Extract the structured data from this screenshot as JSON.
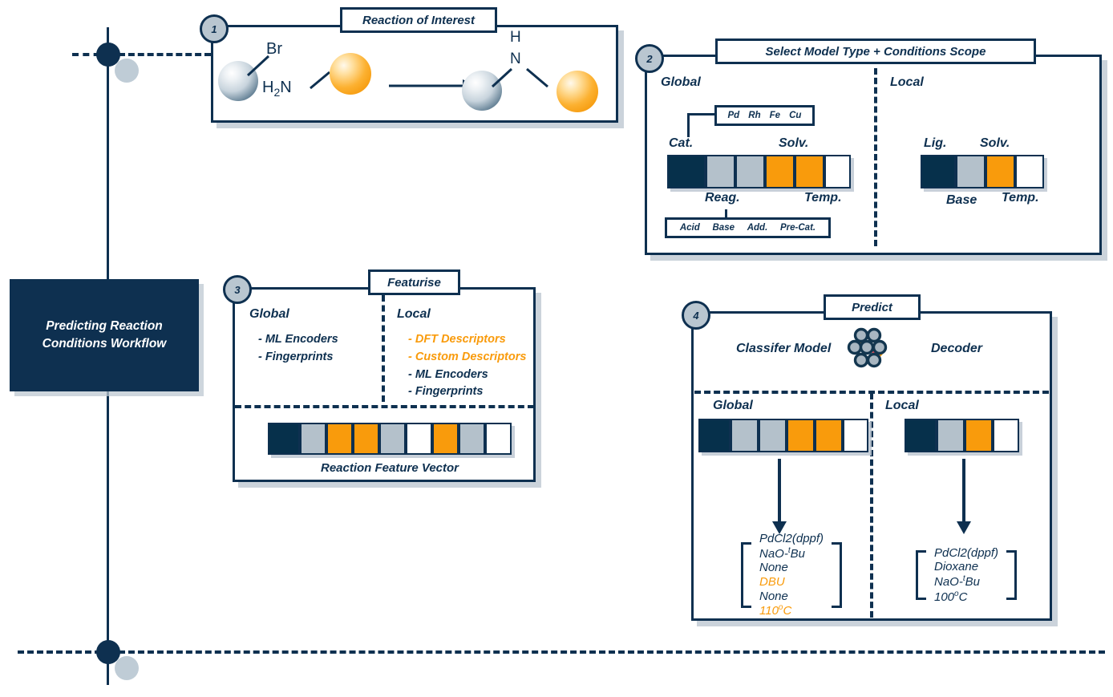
{
  "workflow": {
    "title": "Predicting Reaction\nConditions Workflow"
  },
  "colors": {
    "navy": "#0e3050",
    "cell_navy": "#06304b",
    "gray": "#b4c1cb",
    "orange": "#f99b0c",
    "white": "#ffffff",
    "badge_gray": "#b9c6d0",
    "shadow": "#bec8d2"
  },
  "steps": [
    {
      "number": "1",
      "title": "Reaction of Interest"
    },
    {
      "number": "2",
      "title": "Select Model Type + Conditions Scope"
    },
    {
      "number": "3",
      "title": "Featurise"
    },
    {
      "number": "4",
      "title": "Predict"
    }
  ],
  "step1": {
    "reactant1": {
      "label": "Br",
      "sphere": "gray-sphere"
    },
    "reactant2": {
      "label": "H2N",
      "label_main": "H",
      "label_sub": "2",
      "label_tail": "N",
      "sphere": "orange-sphere"
    },
    "arrow": "reaction-arrow",
    "product": {
      "n_label": "N",
      "h_label": "H",
      "sphere_left": "gray-sphere",
      "sphere_right": "orange-sphere"
    }
  },
  "step2": {
    "global_label": "Global",
    "local_label": "Local",
    "catalyst_options": [
      "Pd",
      "Rh",
      "Fe",
      "Cu"
    ],
    "reagent_options": [
      "Acid",
      "Base",
      "Add.",
      "Pre-Cat."
    ],
    "global_top_labels": {
      "cat": "Cat.",
      "solv": "Solv."
    },
    "global_bottom_labels": {
      "reag": "Reag.",
      "temp": "Temp."
    },
    "local_top_labels": {
      "lig": "Lig.",
      "solv": "Solv."
    },
    "local_bottom_labels": {
      "base": "Base",
      "temp": "Temp."
    },
    "global_bar": [
      "navy",
      "gray",
      "gray",
      "orange",
      "orange",
      "white"
    ],
    "local_bar": [
      "navy",
      "gray",
      "orange",
      "white"
    ]
  },
  "step3": {
    "global_label": "Global",
    "local_label": "Local",
    "global_items": [
      {
        "text": "- ML Encoders",
        "highlight": false
      },
      {
        "text": "- Fingerprints",
        "highlight": false
      }
    ],
    "local_items": [
      {
        "text": "- DFT Descriptors",
        "highlight": true
      },
      {
        "text": "- Custom Descriptors",
        "highlight": true
      },
      {
        "text": "- ML Encoders",
        "highlight": false
      },
      {
        "text": "- Fingerprints",
        "highlight": false
      }
    ],
    "vector_caption": "Reaction Feature Vector",
    "vector_bar": [
      "navy",
      "gray",
      "orange",
      "orange",
      "gray",
      "white",
      "orange",
      "gray",
      "white"
    ]
  },
  "step4": {
    "classifier_label": "Classifer Model",
    "decoder_label": "Decoder",
    "network_icon": "neural-network-icon",
    "global_label": "Global",
    "local_label": "Local",
    "global_bar": [
      "navy",
      "gray",
      "gray",
      "orange",
      "orange",
      "white"
    ],
    "local_bar": [
      "navy",
      "gray",
      "orange",
      "white"
    ],
    "global_prediction": [
      {
        "text": "PdCl2(dppf)",
        "highlight": false
      },
      {
        "text": "NaO-tBu",
        "highlight": false,
        "sup": "t",
        "pre": "NaO-",
        "post": "Bu"
      },
      {
        "text": "None",
        "highlight": false
      },
      {
        "text": "DBU",
        "highlight": true
      },
      {
        "text": "None",
        "highlight": false
      },
      {
        "text": "110oC",
        "highlight": true,
        "pre": "110",
        "sup": "o",
        "post": "C"
      }
    ],
    "local_prediction": [
      {
        "text": "PdCl2(dppf)",
        "highlight": false
      },
      {
        "text": "Dioxane",
        "highlight": false
      },
      {
        "text": "NaO-tBu",
        "highlight": false,
        "pre": "NaO-",
        "sup": "t",
        "post": "Bu"
      },
      {
        "text": "100oC",
        "highlight": false,
        "pre": "100",
        "sup": "o",
        "post": "C"
      }
    ]
  }
}
